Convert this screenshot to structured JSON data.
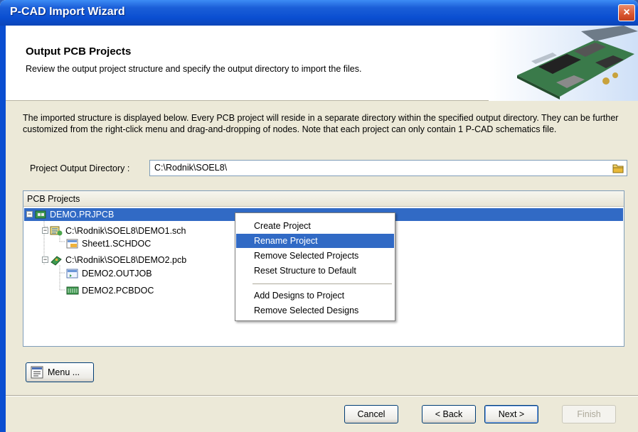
{
  "window": {
    "title": "P-CAD Import Wizard",
    "close_label": "×"
  },
  "header": {
    "title": "Output PCB Projects",
    "subtitle": "Review the output project structure and specify the output directory to import the files."
  },
  "description": "The imported structure is displayed below. Every PCB project will reside in a separate directory within the specified output directory. They can be further customized from the right-click menu and drag-and-dropping of nodes. Note that each project can only contain 1 P-CAD schematics file.",
  "output_dir": {
    "label": "Project Output Directory :",
    "value": "C:\\Rodnik\\SOEL8\\",
    "browse_icon": "folder-icon"
  },
  "tree": {
    "header": "PCB Projects",
    "nodes": [
      {
        "label": "DEMO.PRJPCB",
        "icon": "pcb-project-icon",
        "expander": "−",
        "selected": true
      },
      {
        "label": "C:\\Rodnik\\SOEL8\\DEMO1.sch",
        "icon": "schematic-source-icon",
        "expander": "−"
      },
      {
        "label": "Sheet1.SCHDOC",
        "icon": "schdoc-icon"
      },
      {
        "label": "C:\\Rodnik\\SOEL8\\DEMO2.pcb",
        "icon": "pcb-source-icon",
        "expander": "−"
      },
      {
        "label": "DEMO2.OUTJOB",
        "icon": "outjob-icon"
      },
      {
        "label": "DEMO2.PCBDOC",
        "icon": "pcbdoc-icon"
      }
    ]
  },
  "context_menu": {
    "items": [
      "Create Project",
      "Rename Project",
      "Remove Selected Projects",
      "Reset Structure to Default",
      "Add Designs to Project",
      "Remove Selected Designs"
    ],
    "highlighted": "Rename Project"
  },
  "menu_button": {
    "label": "Menu ...",
    "icon": "menu-icon"
  },
  "buttons": {
    "cancel": "Cancel",
    "back": "< Back",
    "next": "Next >",
    "finish": "Finish"
  }
}
